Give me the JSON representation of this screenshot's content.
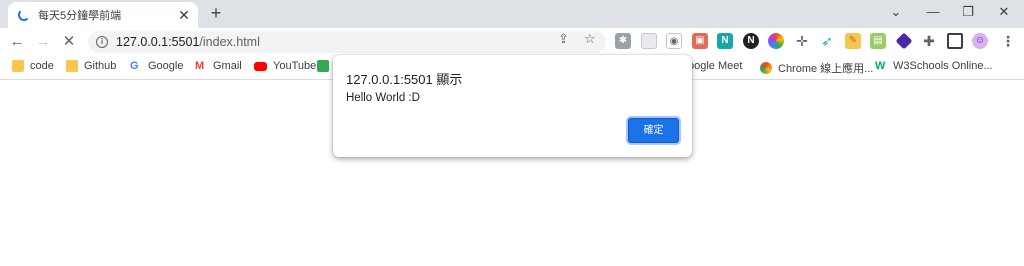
{
  "tab": {
    "title": "每天5分鐘學前端",
    "close": "✕",
    "new": "+"
  },
  "window": {
    "minimize_glyph": "—",
    "restore_glyph": "❐",
    "close_glyph": "✕",
    "menu_glyph": "⌄"
  },
  "nav": {
    "back": "←",
    "forward": "→",
    "stop": "✕"
  },
  "address": {
    "host": "127.0.0.1:5501",
    "path": "/index.html"
  },
  "bookmarks": [
    {
      "label": "code",
      "icon": "folder-icon"
    },
    {
      "label": "Github",
      "icon": "folder-icon"
    },
    {
      "label": "Google",
      "icon": "google-icon"
    },
    {
      "label": "Gmail",
      "icon": "gmail-icon"
    },
    {
      "label": "YouTube",
      "icon": "youtube-icon"
    },
    {
      "label": "oogle Meet",
      "icon": "meet-icon"
    },
    {
      "label": "Chrome 線上應用...",
      "icon": "chrome-webstore-icon"
    },
    {
      "label": "W3Schools Online...",
      "icon": "w3schools-icon"
    }
  ],
  "dialog": {
    "title": "127.0.0.1:5501 顯示",
    "message": "Hello World :D",
    "ok_label": "確定"
  },
  "colors": {
    "accent": "#1a73e8",
    "tabstrip": "#dee1e6",
    "omnibox": "#f1f3f4"
  }
}
